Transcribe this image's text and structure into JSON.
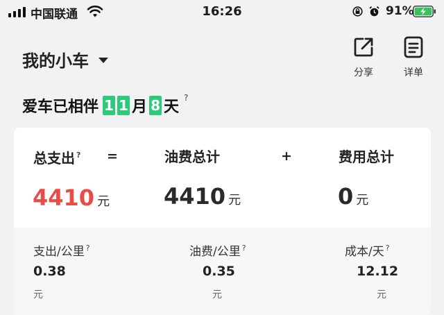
{
  "status_bar": {
    "carrier": "中国联通",
    "time": "16:26",
    "battery_percent": "91%"
  },
  "header": {
    "car_name": "我的小车",
    "share_label": "分享",
    "detail_label": "详单"
  },
  "accompany": {
    "prefix": "爱车已相伴",
    "months_digits": [
      "1",
      "1"
    ],
    "month_unit": "月",
    "days_digits": [
      "8"
    ],
    "day_unit": "天",
    "help": "?"
  },
  "summary": {
    "total": {
      "label": "总支出",
      "help": "?",
      "value": "4410",
      "unit": "元"
    },
    "equals": "=",
    "fuel": {
      "label": "油费总计",
      "value": "4410",
      "unit": "元"
    },
    "plus": "+",
    "fees": {
      "label": "费用总计",
      "value": "0",
      "unit": "元"
    }
  },
  "stats": [
    {
      "label": "支出/公里",
      "help": "?",
      "value": "0.38",
      "unit": "元"
    },
    {
      "label": "油费/公里",
      "help": "?",
      "value": "0.35",
      "unit": "元"
    },
    {
      "label": "成本/天",
      "help": "?",
      "value": "12.12",
      "unit": "元"
    }
  ],
  "colors": {
    "accent_green": "#2fc97c",
    "total_red": "#e94b47",
    "background": "#f2f2f4"
  }
}
